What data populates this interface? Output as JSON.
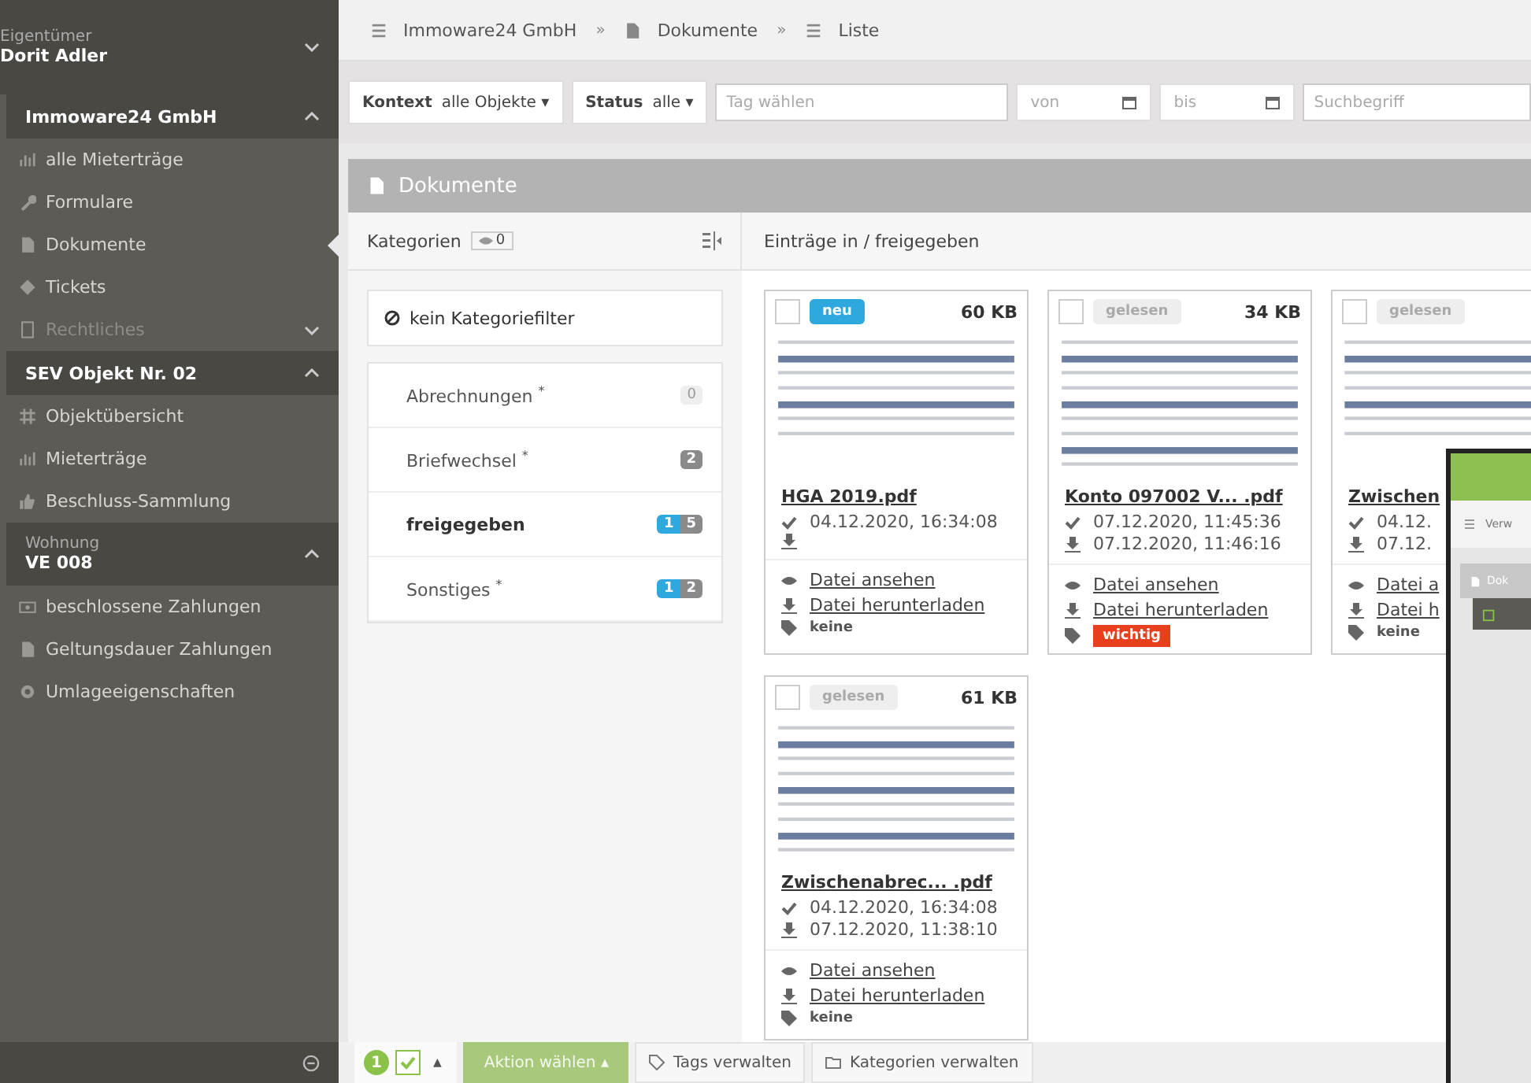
{
  "sidebar": {
    "owner": {
      "label": "Eigentümer",
      "name": "Dorit Adler",
      "expanded": false
    },
    "groups": [
      {
        "title": "Immoware24 GmbH",
        "expanded": true,
        "items": [
          {
            "label": "alle Mieterträge",
            "selected": false,
            "disabled": false
          },
          {
            "label": "Formulare",
            "selected": false,
            "disabled": false
          },
          {
            "label": "Dokumente",
            "selected": true,
            "disabled": false
          },
          {
            "label": "Tickets",
            "selected": false,
            "disabled": false
          },
          {
            "label": "Rechtliches",
            "selected": false,
            "disabled": true,
            "expanded": false
          }
        ]
      },
      {
        "title": "SEV Objekt Nr. 02",
        "expanded": true,
        "items": [
          {
            "label": "Objektübersicht",
            "selected": false,
            "disabled": false
          },
          {
            "label": "Mieterträge",
            "selected": false,
            "disabled": false
          },
          {
            "label": "Beschluss-Sammlung",
            "selected": false,
            "disabled": false
          }
        ]
      },
      {
        "subtitle": "Wohnung",
        "title": "VE 008",
        "expanded": true,
        "items": [
          {
            "label": "beschlossene Zahlungen",
            "selected": false,
            "disabled": false
          },
          {
            "label": "Geltungsdauer Zahlungen",
            "selected": false,
            "disabled": false
          },
          {
            "label": "Umlageeigenschaften",
            "selected": false,
            "disabled": false
          }
        ]
      }
    ]
  },
  "breadcrumb": [
    {
      "label": "Immoware24 GmbH"
    },
    {
      "separator": "»",
      "label": "Dokumente"
    },
    {
      "separator": "»",
      "label": "Liste"
    }
  ],
  "filters": {
    "context": {
      "label": "Kontext",
      "value": "alle Objekte ▾"
    },
    "status": {
      "label": "Status",
      "value": "alle ▾"
    },
    "tag": {
      "placeholder": "Tag wählen"
    },
    "from": {
      "placeholder": "von"
    },
    "to": {
      "placeholder": "bis"
    },
    "search": {
      "placeholder": "Suchbegriff"
    }
  },
  "panel": {
    "title": "Dokumente",
    "categories_label": "Kategorien",
    "categories_count": "0",
    "entries_label": "Einträge in / freigegeben"
  },
  "no_filter": "kein Kategoriefilter",
  "categories": [
    {
      "label": "Abrechnungen $^{*}$",
      "selected": false,
      "count": "0",
      "count_muted": true
    },
    {
      "label": "Briefwechsel $^{*}$",
      "selected": false,
      "count": "2",
      "count_muted": false
    },
    {
      "label": "freigegeben",
      "selected": true,
      "unread": "1",
      "count": "5",
      "count_muted": false
    },
    {
      "label": "Sonstiges $^{*}$",
      "selected": false,
      "unread": "1",
      "count": "2",
      "count_muted": false
    }
  ],
  "documents": [
    {
      "checked": false,
      "status": "neu",
      "status_highlighted": true,
      "size": "60 KB",
      "name": "HGA 2019.pdf",
      "read": "04.12.2020, 16:34:08",
      "view": "Datei ansehen",
      "download": "Datei herunterladen",
      "tag": "keine",
      "tag_highlighted": false
    },
    {
      "checked": false,
      "status": "gelesen",
      "status_highlighted": false,
      "size": "34 KB",
      "name": "Konto 097002 V... .pdf",
      "read": "07.12.2020, 11:45:36",
      "downloaded": "07.12.2020, 11:46:16",
      "view": "Datei ansehen",
      "download": "Datei herunterladen",
      "tag": "wichtig",
      "tag_highlighted": true
    },
    {
      "checked": false,
      "status": "gelesen",
      "status_highlighted": false,
      "name": "Zwischen",
      "read": "04.12.",
      "downloaded": "07.12.",
      "view": "Datei a",
      "download": "Datei h",
      "tag": "keine",
      "tag_highlighted": false
    },
    {
      "checked": false,
      "status": "gelesen",
      "status_highlighted": false,
      "size": "61 KB",
      "name": "Zwischenabrec... .pdf",
      "read": "04.12.2020, 16:34:08",
      "downloaded": "07.12.2020, 11:38:10",
      "view": "Datei ansehen",
      "download": "Datei herunterladen",
      "tag": "keine",
      "tag_highlighted": false
    }
  ],
  "toolbar": {
    "selected_count": "1",
    "all_checked": true,
    "caret": "▲",
    "action": "Aktion wählen ▴",
    "tags": "Tags verwalten",
    "categories": "Kategorien verwalten"
  },
  "inset": {
    "toolbar_text": "Verw",
    "panel_text": "Dok"
  }
}
